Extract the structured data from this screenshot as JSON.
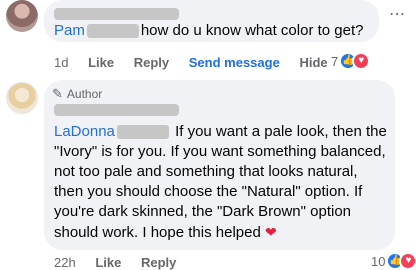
{
  "comment1": {
    "author": "Pam",
    "text": "how do u know what color to get?",
    "actions": {
      "time": "1d",
      "like": "Like",
      "reply": "Reply",
      "send_message": "Send message",
      "hide": "Hide"
    },
    "reactions": {
      "count": "7"
    }
  },
  "comment2": {
    "badge": "Author",
    "author": "LaDonna",
    "text": "If you want a pale look, then the \"Ivory\" is for you. If you want something balanced, not too pale and something that looks natural, then you should choose the \"Natural\" option. If you're dark skinned, the \"Dark Brown\" option should work. I hope this helped",
    "actions": {
      "time": "22h",
      "like": "Like",
      "reply": "Reply"
    },
    "reactions": {
      "count": "10"
    }
  },
  "colors": {
    "bubble": "#f0f2f5",
    "link": "#216fdb",
    "muted": "#65676b",
    "like": "#1877f2",
    "love": "#f33e58"
  },
  "icons": [
    "more-icon",
    "like-icon",
    "love-icon",
    "pencil-icon",
    "heart-icon"
  ]
}
